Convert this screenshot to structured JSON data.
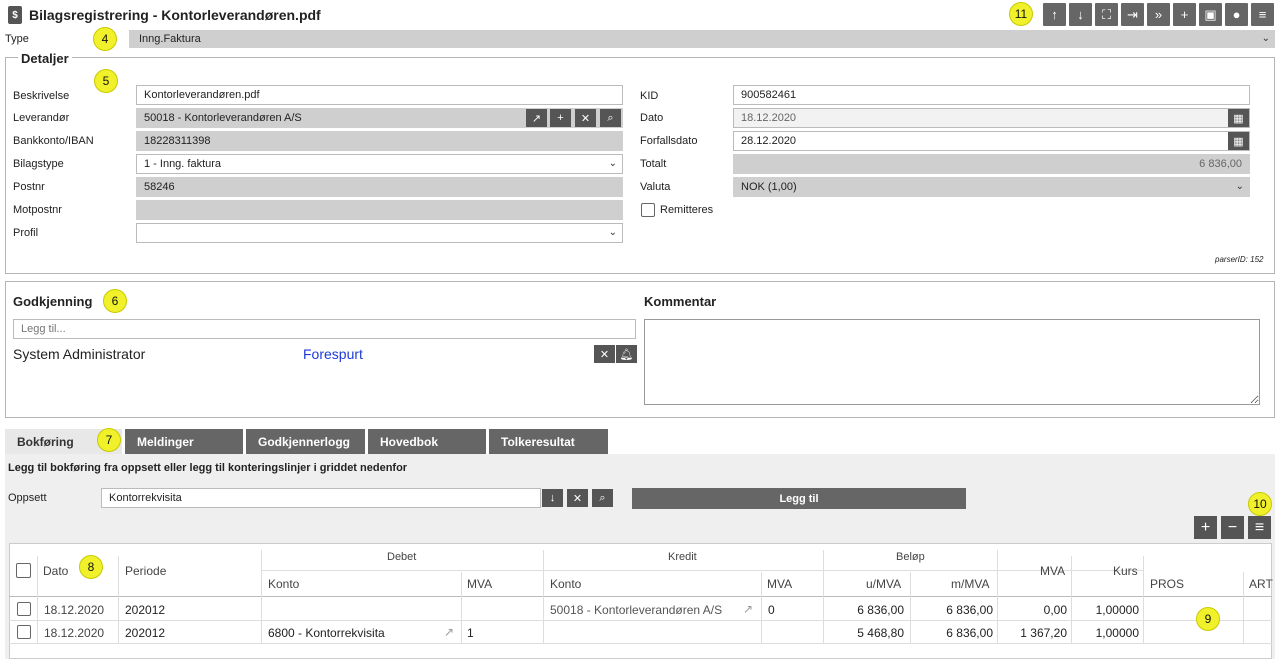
{
  "header": {
    "title": "Bilagsregistrering - Kontorleverandøren.pdf"
  },
  "badges": {
    "b4": "4",
    "b5": "5",
    "b6": "6",
    "b7": "7",
    "b8": "8",
    "b9": "9",
    "b10": "10",
    "b11": "11"
  },
  "toolbar": {
    "icons": [
      "arrow-up",
      "arrow-down",
      "expand",
      "next",
      "fast-forward",
      "plus",
      "save",
      "comment",
      "menu"
    ],
    "glyphs": [
      "↑",
      "↓",
      "⛶",
      "⇥",
      "»",
      "+",
      "▣",
      "●",
      "≡"
    ]
  },
  "type": {
    "label": "Type",
    "value": "Inng.Faktura"
  },
  "details": {
    "legend": "Detaljer",
    "beskrivelse_label": "Beskrivelse",
    "beskrivelse": "Kontorleverandøren.pdf",
    "leverandor_label": "Leverandør",
    "leverandor": "50018 - Kontorleverandøren A/S",
    "bankkonto_label": "Bankkonto/IBAN",
    "bankkonto": "18228311398",
    "bilagstype_label": "Bilagstype",
    "bilagstype": "1 - Inng. faktura",
    "postnr_label": "Postnr",
    "postnr": "58246",
    "motpostnr_label": "Motpostnr",
    "motpostnr": "",
    "profil_label": "Profil",
    "profil": "",
    "kid_label": "KID",
    "kid": "900582461",
    "dato_label": "Dato",
    "dato": "18.12.2020",
    "forfall_label": "Forfallsdato",
    "forfall": "28.12.2020",
    "totalt_label": "Totalt",
    "totalt": "6 836,00",
    "valuta_label": "Valuta",
    "valuta": "NOK (1,00)",
    "remitteres_label": "Remitteres",
    "parser": "parserID: 152"
  },
  "approval": {
    "title": "Godkjenning",
    "placeholder": "Legg til...",
    "user": "System Administrator",
    "status": "Forespurt"
  },
  "comment": {
    "title": "Kommentar"
  },
  "tabs": [
    "Bokføring",
    "Meldinger",
    "Godkjennerlogg",
    "Hovedbok",
    "Tolkeresultat"
  ],
  "booking": {
    "instruction": "Legg til bokføring fra oppsett eller legg til konteringslinjer i griddet nedenfor",
    "oppsett_label": "Oppsett",
    "oppsett": "Kontorrekvisita",
    "add_button": "Legg til"
  },
  "grid": {
    "headers": {
      "dato": "Dato",
      "periode": "Periode",
      "debet": "Debet",
      "kredit": "Kredit",
      "belop": "Beløp",
      "konto": "Konto",
      "mva": "MVA",
      "umva": "u/MVA",
      "mmva": "m/MVA",
      "mva2": "MVA",
      "kurs": "Kurs",
      "pros": "PROS",
      "art": "ART"
    },
    "rows": [
      {
        "dato": "18.12.2020",
        "periode": "202012",
        "dkonto": "",
        "dmva": "",
        "kkonto": "50018 - Kontorleverandøren A/S",
        "kmva": "0",
        "umva": "6 836,00",
        "mmva": "6 836,00",
        "mva": "0,00",
        "kurs": "1,00000"
      },
      {
        "dato": "18.12.2020",
        "periode": "202012",
        "dkonto": "6800 - Kontorrekvisita",
        "dmva": "1",
        "kkonto": "",
        "kmva": "",
        "umva": "5 468,80",
        "mmva": "6 836,00",
        "mva": "1 367,20",
        "kurs": "1,00000"
      }
    ]
  }
}
